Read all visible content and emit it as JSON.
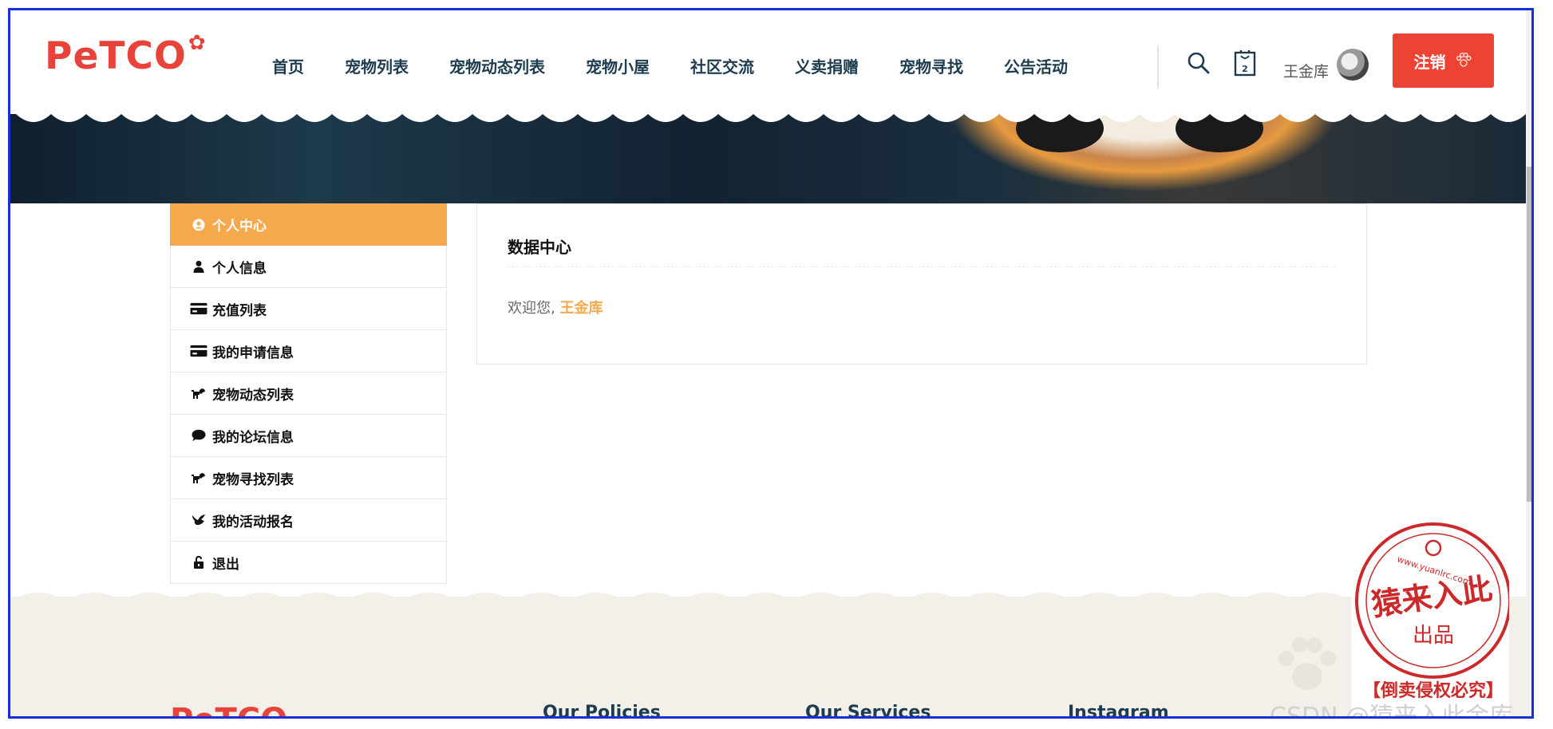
{
  "brand": {
    "logo_text": "PeTCO",
    "footer_logo_text": "PeTCO"
  },
  "nav": {
    "items": [
      "首页",
      "宠物列表",
      "宠物动态列表",
      "宠物小屋",
      "社区交流",
      "义卖捐赠",
      "宠物寻找",
      "公告活动"
    ]
  },
  "header": {
    "cart_count": "2",
    "user_name": "王金库",
    "logout_label": "注销"
  },
  "sidebar": {
    "items": [
      {
        "label": "个人中心",
        "icon": "user-circle-icon",
        "active": true
      },
      {
        "label": "个人信息",
        "icon": "user-icon"
      },
      {
        "label": "充值列表",
        "icon": "credit-card-icon"
      },
      {
        "label": "我的申请信息",
        "icon": "credit-card-icon"
      },
      {
        "label": "宠物动态列表",
        "icon": "dog-icon"
      },
      {
        "label": "我的论坛信息",
        "icon": "comment-icon"
      },
      {
        "label": "宠物寻找列表",
        "icon": "dog-icon"
      },
      {
        "label": "我的活动报名",
        "icon": "bird-icon"
      },
      {
        "label": "退出",
        "icon": "unlock-icon"
      }
    ]
  },
  "main": {
    "title": "数据中心",
    "welcome_prefix": "欢迎您,",
    "welcome_name": "王金库"
  },
  "footer": {
    "columns": [
      "Our Policies",
      "Our Services",
      "Instagram"
    ]
  },
  "watermark": {
    "stamp_main": "猿来入此",
    "stamp_sub": "出品",
    "stamp_bottom": "【倒卖侵权必究】",
    "stamp_url": "www.yuanlrc.com",
    "csdn": "CSDN @猿来入此金库"
  },
  "colors": {
    "accent": "#f5a94c",
    "brand_red": "#ec4335",
    "nav_text": "#1e3c4f"
  }
}
